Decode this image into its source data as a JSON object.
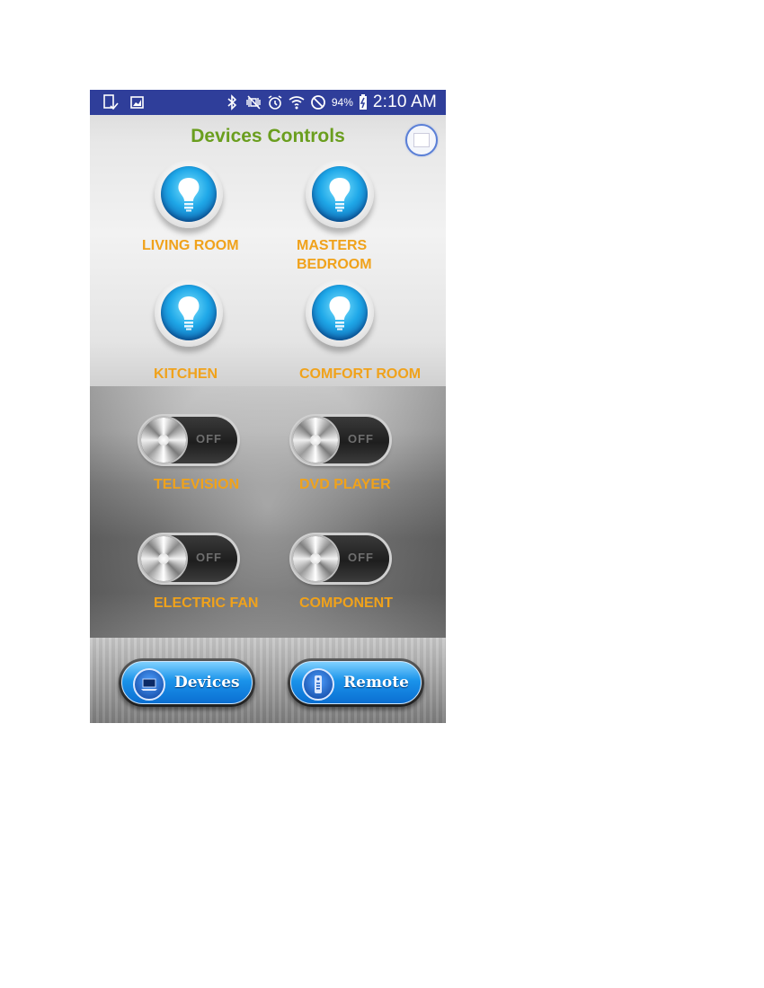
{
  "status_bar": {
    "battery": "94%",
    "time": "2:10 AM",
    "icons_left": [
      "tablet-check-icon",
      "image-icon"
    ],
    "icons_right": [
      "bluetooth-icon",
      "vibrate-off-icon",
      "alarm-icon",
      "wifi-icon",
      "block-icon",
      "battery-charging-icon"
    ]
  },
  "header": {
    "title": "Devices Controls",
    "avatar_icon": "user-avatar-icon"
  },
  "lights": [
    {
      "label": "LIVING ROOM"
    },
    {
      "label": "MASTERS\nBEDROOM"
    },
    {
      "label": "KITCHEN"
    },
    {
      "label": "COMFORT ROOM"
    }
  ],
  "switches": [
    {
      "label": "TELEVISION",
      "state": "OFF"
    },
    {
      "label": "DVD PLAYER",
      "state": "OFF"
    },
    {
      "label": "ELECTRIC FAN",
      "state": "OFF"
    },
    {
      "label": "COMPONENT",
      "state": "OFF"
    }
  ],
  "nav": {
    "devices_label": "Devices",
    "remote_label": "Remote"
  },
  "colors": {
    "status_bar": "#2f3e9a",
    "title": "#6a9e1e",
    "label": "#f0a21b",
    "button_blue": "#1a93ea"
  }
}
